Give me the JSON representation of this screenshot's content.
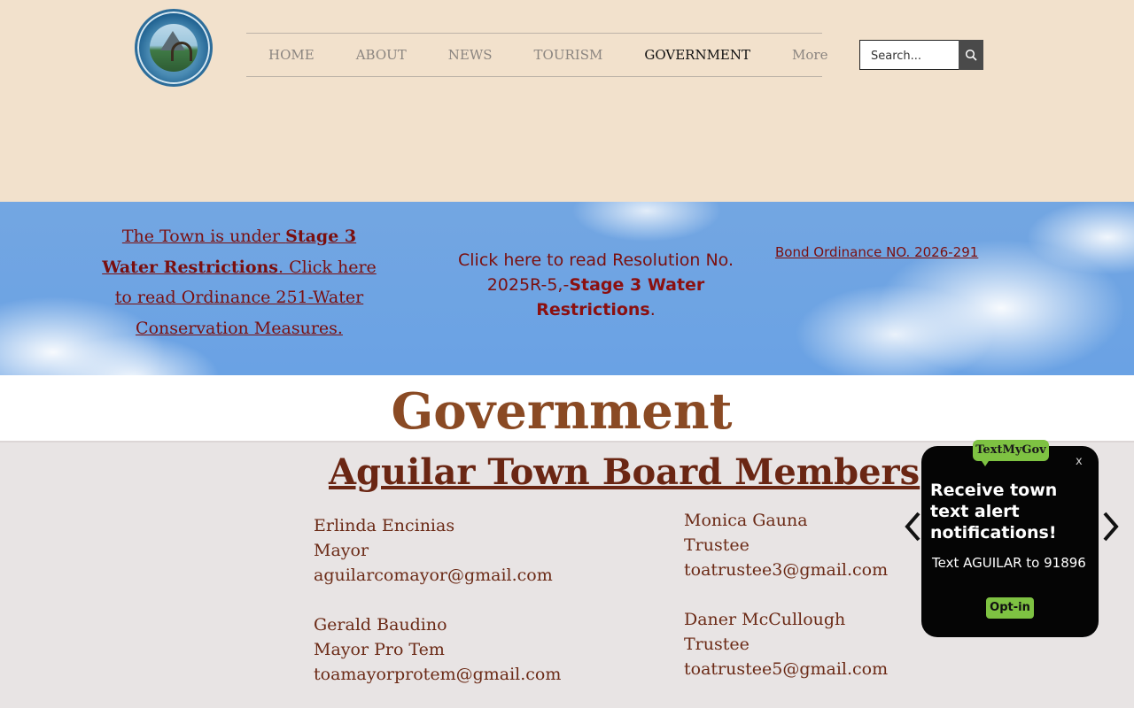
{
  "header": {
    "logo_alt": "Town of Aguilar seal",
    "nav": [
      "HOME",
      "ABOUT",
      "NEWS",
      "TOURISM",
      "GOVERNMENT",
      "More"
    ],
    "active_nav": "GOVERNMENT",
    "search": {
      "placeholder": "Search..."
    }
  },
  "banner": {
    "left_part1": "The Town is under ",
    "left_bold": "Stage 3 Water Restrictions",
    "left_part2": ". Click here to read Ordinance 251-Water Conservation Measures.",
    "mid_part1": "Click here to read Resolution No. 2025R-5,-",
    "mid_bold": "Stage 3 Water Restrictions",
    "mid_part2": ".",
    "right_link": "Bond Ordinance NO. 2026-291"
  },
  "page_title": "Government",
  "board": {
    "heading": "Aguilar Town Board Members",
    "members_left": [
      {
        "name": "Erlinda Encinias",
        "role": "Mayor",
        "email": "aguilarcomayor@gmail.com"
      },
      {
        "name": "Gerald Baudino",
        "role": "Mayor Pro Tem",
        "email": "toamayorprotem@gmail.com"
      }
    ],
    "members_right": [
      {
        "name": "Monica Gauna",
        "role": "Trustee",
        "email": "toatrustee3@gmail.com"
      },
      {
        "name": "Daner McCullough",
        "role": "Trustee",
        "email": "toatrustee5@gmail.com"
      }
    ]
  },
  "popup": {
    "badge": "TextMyGov",
    "close": "x",
    "headline": "Receive town text alert notifications!",
    "body": "Text AGUILAR to 91896",
    "button": "Opt-in"
  },
  "colors": {
    "header_bg": "#f2e1cc",
    "title_color": "#8a4a24",
    "member_text": "#6b2a16",
    "banner_text": "#7a0f0f",
    "popup_accent": "#7ec242"
  },
  "icons": {
    "search": "search-icon",
    "prev": "chevron-left-icon",
    "next": "chevron-right-icon"
  }
}
